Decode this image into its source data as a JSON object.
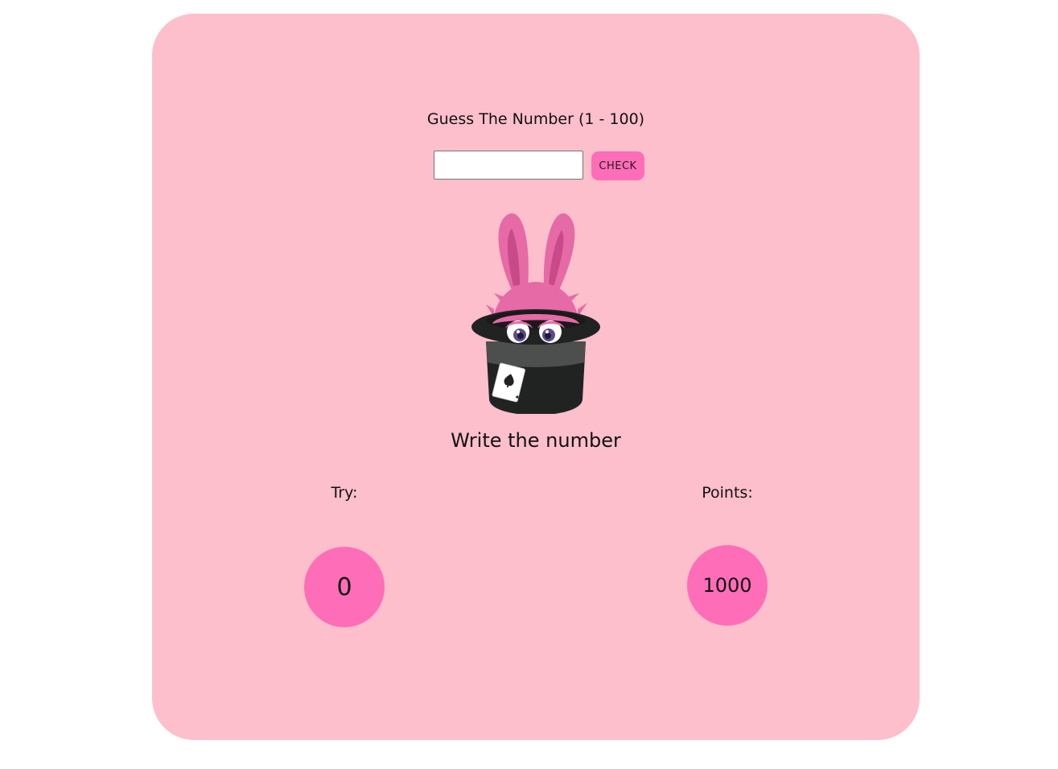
{
  "game": {
    "title": "Guess The Number (1 - 100)",
    "input": {
      "value": "",
      "placeholder": ""
    },
    "check_label": "CHECK",
    "mascot": "rabbit-in-top-hat-illustration",
    "message": "Write the number",
    "stats": {
      "try_label": "Try:",
      "try_value": "0",
      "points_label": "Points:",
      "points_value": "1000"
    }
  },
  "colors": {
    "card_background": "#fdbfcb",
    "accent_pink": "#fe6db7",
    "page_background": "#ffffff"
  }
}
